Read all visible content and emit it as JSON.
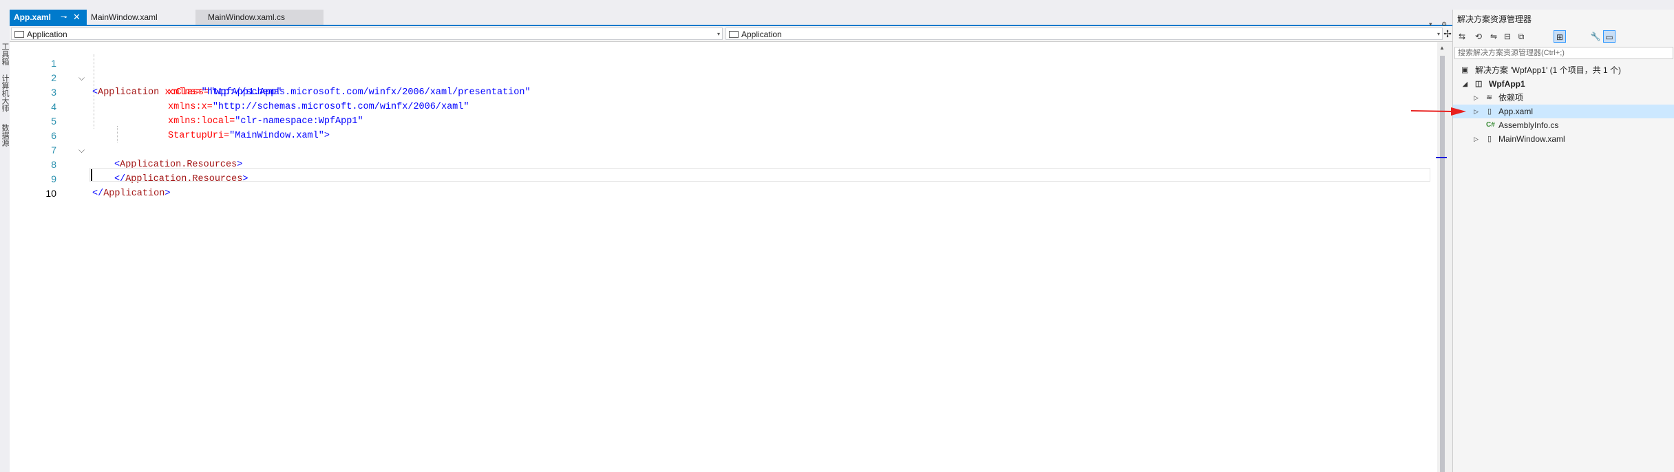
{
  "left_strip": {
    "tab1": "工具箱",
    "tab2": "计算机大师",
    "tab3": "数据源"
  },
  "tabs": [
    {
      "label": "App.xaml",
      "pin": "⊸",
      "close": "✕"
    },
    {
      "label": "MainWindow.xaml"
    },
    {
      "label": "MainWindow.xaml.cs"
    }
  ],
  "tabbar_icons": {
    "dropdown": "▾",
    "settings": "⚙"
  },
  "navbar": {
    "left_value": "Application",
    "right_value": "Application",
    "split": "✢"
  },
  "code": {
    "line_numbers": [
      "1",
      "2",
      "3",
      "4",
      "5",
      "6",
      "7",
      "8",
      "9",
      "10"
    ],
    "l1": {
      "open": "<",
      "tag": "Application",
      "attr": " x:Class=",
      "val": "\"WpfApp1.App\""
    },
    "l2": {
      "attr": "xmlns=",
      "val": "\"http://schemas.microsoft.com/winfx/2006/xaml/presentation\""
    },
    "l3": {
      "attr": "xmlns:x=",
      "val": "\"http://schemas.microsoft.com/winfx/2006/xaml\""
    },
    "l4": {
      "attr": "xmlns:local=",
      "val": "\"clr-namespace:WpfApp1\""
    },
    "l5": {
      "attr": "StartupUri=",
      "val": "\"MainWindow.xaml\"",
      "close": ">"
    },
    "l6": {
      "open": "<",
      "tag": "Application.Resources",
      "close": ">"
    },
    "l8": {
      "open": "</",
      "tag": "Application.Resources",
      "close": ">"
    },
    "l9": {
      "open": "</",
      "tag": "Application",
      "close": ">"
    }
  },
  "solution_explorer": {
    "title": "解决方案资源管理器",
    "search_placeholder": "搜索解决方案资源管理器(Ctrl+;)",
    "toolbar_icons": [
      "sync-icon",
      "history-icon",
      "switch-icon",
      "collapse-icon",
      "copy-icon",
      "filter-icon",
      "wrench-icon",
      "preview-icon"
    ],
    "items": [
      {
        "label": "解决方案 'WpfApp1' (1 个项目，共 1 个)",
        "icon": "solution-icon",
        "icon_glyph": "▣"
      },
      {
        "label": "WpfApp1",
        "icon": "project-icon",
        "icon_glyph": "◫",
        "expander": "◢"
      },
      {
        "label": "依赖项",
        "icon": "dependencies-icon",
        "icon_glyph": "≋",
        "expander": "▷"
      },
      {
        "label": "App.xaml",
        "icon": "xaml-file-icon",
        "icon_glyph": "▯",
        "expander": "▷"
      },
      {
        "label": "AssemblyInfo.cs",
        "icon": "csharp-file-icon",
        "icon_glyph": "C#"
      },
      {
        "label": "MainWindow.xaml",
        "icon": "xaml-file-icon",
        "icon_glyph": "▯",
        "expander": "▷"
      }
    ]
  },
  "colors": {
    "accent": "#007acc",
    "tag": "#a31515",
    "attr": "#ff0000",
    "value": "#0000ff",
    "annotation_arrow": "#e8211f"
  }
}
